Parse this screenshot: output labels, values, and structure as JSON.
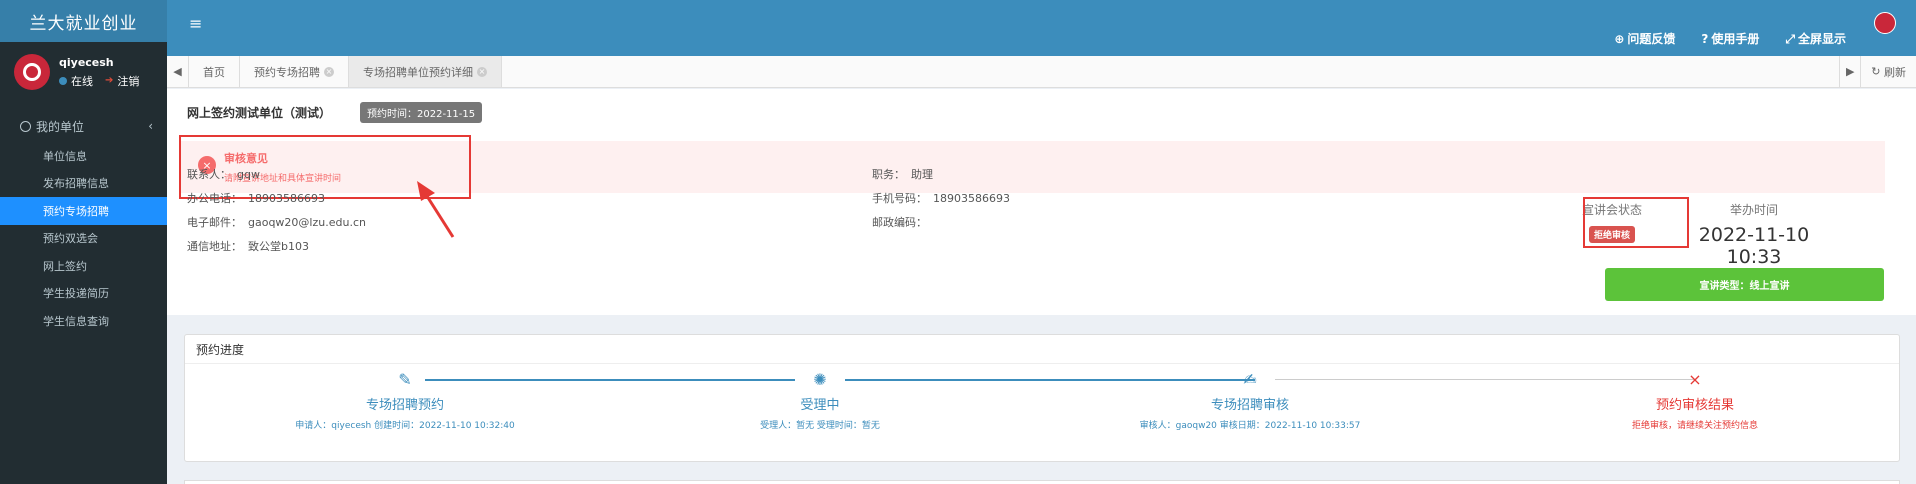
{
  "sidebar": {
    "brand": "兰大就业创业",
    "user": {
      "name": "qiyecesh",
      "online": "在线",
      "logout": "注销"
    },
    "group": "我的单位",
    "items": [
      {
        "label": "单位信息"
      },
      {
        "label": "发布招聘信息"
      },
      {
        "label": "预约专场招聘"
      },
      {
        "label": "预约双选会"
      },
      {
        "label": "网上签约"
      },
      {
        "label": "学生投递简历"
      },
      {
        "label": "学生信息查询"
      }
    ],
    "active_index": 2
  },
  "header": {
    "links": [
      {
        "icon": "question-circle-icon",
        "label": "问题反馈"
      },
      {
        "icon": "help-icon",
        "label": "使用手册"
      },
      {
        "icon": "fullscreen-icon",
        "label": "全屏显示"
      }
    ]
  },
  "tabs": {
    "items": [
      {
        "label": "首页",
        "closable": false
      },
      {
        "label": "预约专场招聘",
        "closable": true
      },
      {
        "label": "专场招聘单位预约详细",
        "closable": true
      }
    ],
    "refresh": "刷新"
  },
  "detail": {
    "unit_name": "网上签约测试单位（测试）",
    "book_time": "预约时间：2022-11-15",
    "alert_title": "审核意见",
    "alert_desc": "请附宣讲地址和具体宣讲时间",
    "contact_label": "联系人：",
    "contact_value": "gqw",
    "office_phone_label": "办公电话：",
    "office_phone_value": "18903586693",
    "email_label": "电子邮件：",
    "email_value": "gaoqw20@lzu.edu.cn",
    "address_label": "通信地址：",
    "address_value": "致公堂b103",
    "position_label": "职务：",
    "position_value": "助理",
    "mobile_label": "手机号码：",
    "mobile_value": "18903586693",
    "postcode_label": "邮政编码：",
    "postcode_value": "",
    "status_title": "宣讲会状态",
    "status_badge": "拒绝审核",
    "hold_time_title": "举办时间",
    "hold_time_value": "2022-11-10 10:33",
    "type_button": "宣讲类型：线上宣讲"
  },
  "progress": {
    "title": "预约进度",
    "steps": [
      {
        "icon": "pencil-icon",
        "title": "专场招聘预约",
        "sub": "申请人：qiyecesh 创建时间：2022-11-10 10:32:40"
      },
      {
        "icon": "spinner-icon",
        "title": "受理中",
        "sub": "受理人：暂无 受理时间：暂无"
      },
      {
        "icon": "edit-icon",
        "title": "专场招聘审核",
        "sub": "审核人：gaoqw20 审核日期：2022-11-10 10:33:57"
      },
      {
        "icon": "close-icon",
        "title": "预约审核结果",
        "sub": "拒绝审核，请继续关注预约信息"
      }
    ]
  },
  "colors": {
    "header": "#3c8dbc",
    "sidebar": "#222d32",
    "active": "#1e90ff",
    "danger": "#e53935",
    "success": "#5cc33a"
  }
}
